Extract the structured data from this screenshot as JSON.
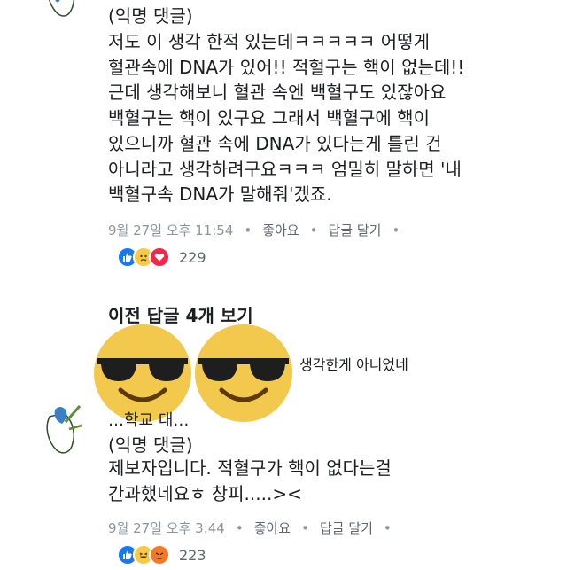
{
  "comment1": {
    "author": "(익명 댓글)",
    "lines": [
      "저도 이 생각 한적 있는데ㅋㅋㅋㅋㅋ 어떻게",
      "혈관속에  DNA가 있어!! 적혈구는 핵이 없는데!!",
      "근데 생각해보니 혈관 속엔 백혈구도 있잖아요",
      "백혈구는 핵이 있구요 그래서 백혈구에 핵이",
      "있으니까 혈관 속에 DNA가 있다는게 틀린 건",
      "아니라고 생각하려구요ㅋㅋㅋ 엄밀히 말하면 '내",
      "백혈구속 DNA가 말해줘'겠죠."
    ],
    "timestamp": "9월 27일 오후 11:54",
    "like_label": "좋아요",
    "reply_label": "답글 달기",
    "reaction_count": "229"
  },
  "prev_replies_label": "이전 답글 4개 보기",
  "hidden_reply": {
    "partial_text": "생각한게 아니었네",
    "partial_name": "…학교 대…"
  },
  "comment2": {
    "author": "(익명 댓글)",
    "lines": [
      "제보자입니다. 적혈구가 핵이 없다는걸",
      "간과했네요ㅎ 창피.....><"
    ],
    "timestamp": "9월 27일 오후 3:44",
    "like_label": "좋아요",
    "reply_label": "답글 달기",
    "reaction_count": "223"
  },
  "colors": {
    "like": "#1877f2",
    "love": "#f02849",
    "emoji_yellow": "#f2c94c",
    "meta_gray": "#8d949e"
  }
}
